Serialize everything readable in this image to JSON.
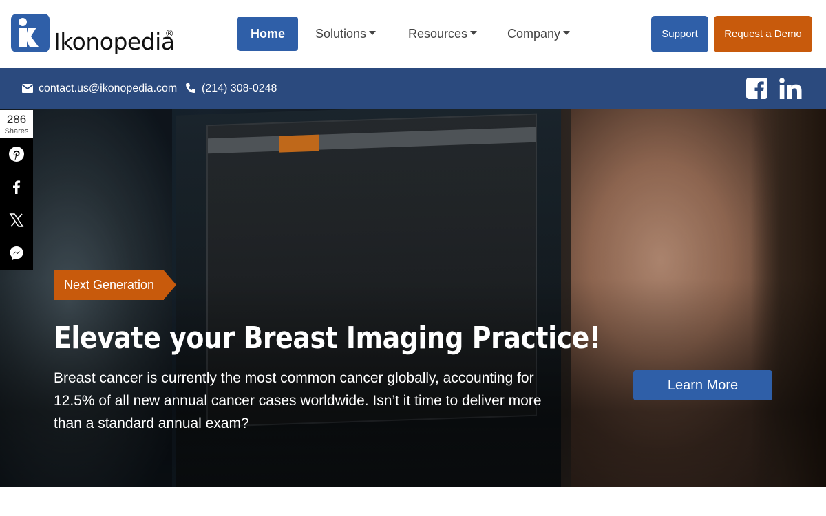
{
  "brand": {
    "name": "Ikonopedia",
    "registered": "®"
  },
  "nav": {
    "home": "Home",
    "solutions": "Solutions",
    "resources": "Resources",
    "company": "Company"
  },
  "header_buttons": {
    "support": "Support",
    "demo": "Request a Demo"
  },
  "contact": {
    "email": "contact.us@ikonopedia.com",
    "phone": "(214) 308-0248"
  },
  "share": {
    "count": "286",
    "label": "Shares",
    "icons": [
      "pinterest-icon",
      "facebook-icon",
      "x-icon",
      "messenger-icon"
    ]
  },
  "hero": {
    "tag": "Next Generation",
    "title": "Elevate your Breast Imaging Practice!",
    "description": "Breast cancer is currently the most common cancer globally, accounting for 12.5% of all new annual cancer cases worldwide. Isn’t it time to deliver more than a standard annual exam?",
    "cta": "Learn More"
  },
  "colors": {
    "primary": "#2f5fa8",
    "accent": "#c85a0c",
    "topbar": "#2b4a7e"
  }
}
